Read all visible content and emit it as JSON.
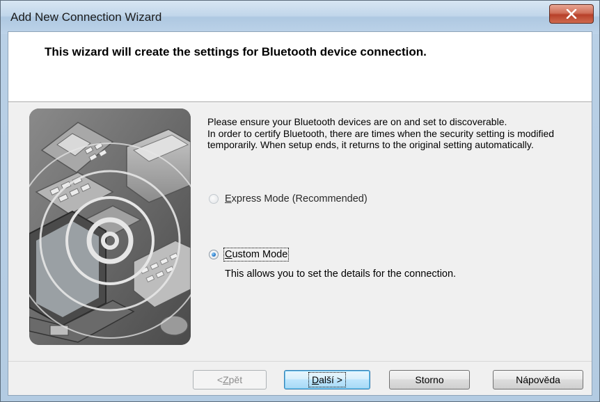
{
  "window": {
    "title": "Add New Connection Wizard",
    "close_icon": "close-x-icon"
  },
  "header": {
    "title": "This wizard will create the settings for Bluetooth device connection."
  },
  "illustration": {
    "icon": "bluetooth-devices-illustration"
  },
  "message": {
    "line1": "Please ensure your Bluetooth devices are on and set to discoverable.",
    "line2": "In order to certify Bluetooth, there are times when the security setting is modified temporarily. When setup ends, it returns to the original setting automatically."
  },
  "options": {
    "express": {
      "label_mnemonic": "E",
      "label_rest": "xpress Mode (Recommended)",
      "selected": false
    },
    "custom": {
      "label_mnemonic": "C",
      "label_rest": "ustom Mode",
      "selected": true,
      "description": "This allows you to set the details for the connection."
    }
  },
  "buttons": {
    "back": {
      "prefix": "< ",
      "mnemonic": "Z",
      "rest": "pět",
      "enabled": false
    },
    "next": {
      "mnemonic": "D",
      "rest": "alší >",
      "default": true
    },
    "cancel": {
      "label": "Storno"
    },
    "help": {
      "label": "Nápověda"
    }
  },
  "colors": {
    "titlebar": "#b9d0e6",
    "close_button": "#c75a40",
    "dialog_bg": "#f0f0f0",
    "header_bg": "#ffffff",
    "default_button_border": "#3c7fb1",
    "radio_selected": "#1f6fbf"
  }
}
